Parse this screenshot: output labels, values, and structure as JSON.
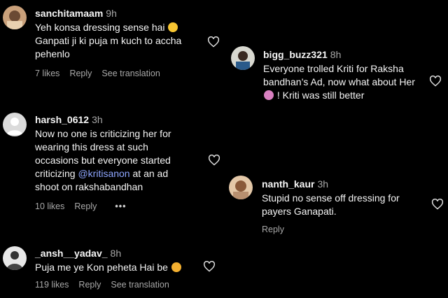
{
  "comments": [
    {
      "username": "sanchitamaam",
      "time": "9h",
      "lines": [
        "Yeh konsa dressing sense hai",
        "Ganpati ji ki puja m kuch to accha",
        "pehenlo"
      ],
      "likes": "7 likes",
      "reply": "Reply",
      "translation": "See translation"
    },
    {
      "username": "bigg_buzz321",
      "time": "8h",
      "lines": [
        "Everyone trolled Kriti for Raksha",
        "bandhan’s Ad, now what about Her",
        "! Kriti was still better"
      ]
    },
    {
      "username": "harsh_0612",
      "time": "3h",
      "lines": [
        "Now no one is criticizing her for",
        "wearing this dress at such",
        "occasions but everyone started"
      ],
      "mention_prefix": "criticizing ",
      "mention": "@kritisanon",
      "mention_suffix": " at an ad",
      "last_line": "shoot on rakshabandhan",
      "likes": "10 likes",
      "reply": "Reply",
      "more": "•••"
    },
    {
      "username": "nanth_kaur",
      "time": "3h",
      "lines": [
        "Stupid no sense off dressing for",
        "payers Ganapati."
      ],
      "reply": "Reply"
    },
    {
      "username": "_ansh__yadav_",
      "time": "8h",
      "lines": [
        "Puja me ye Kon peheta Hai be"
      ],
      "likes": "119 likes",
      "reply": "Reply",
      "translation": "See translation"
    }
  ],
  "icons": {
    "like": "heart-outline-icon",
    "avatar_default": "default-avatar-icon"
  },
  "colors": {
    "background": "#000000",
    "mention": "#8ea6ff",
    "secondary": "#a8a8a8"
  }
}
